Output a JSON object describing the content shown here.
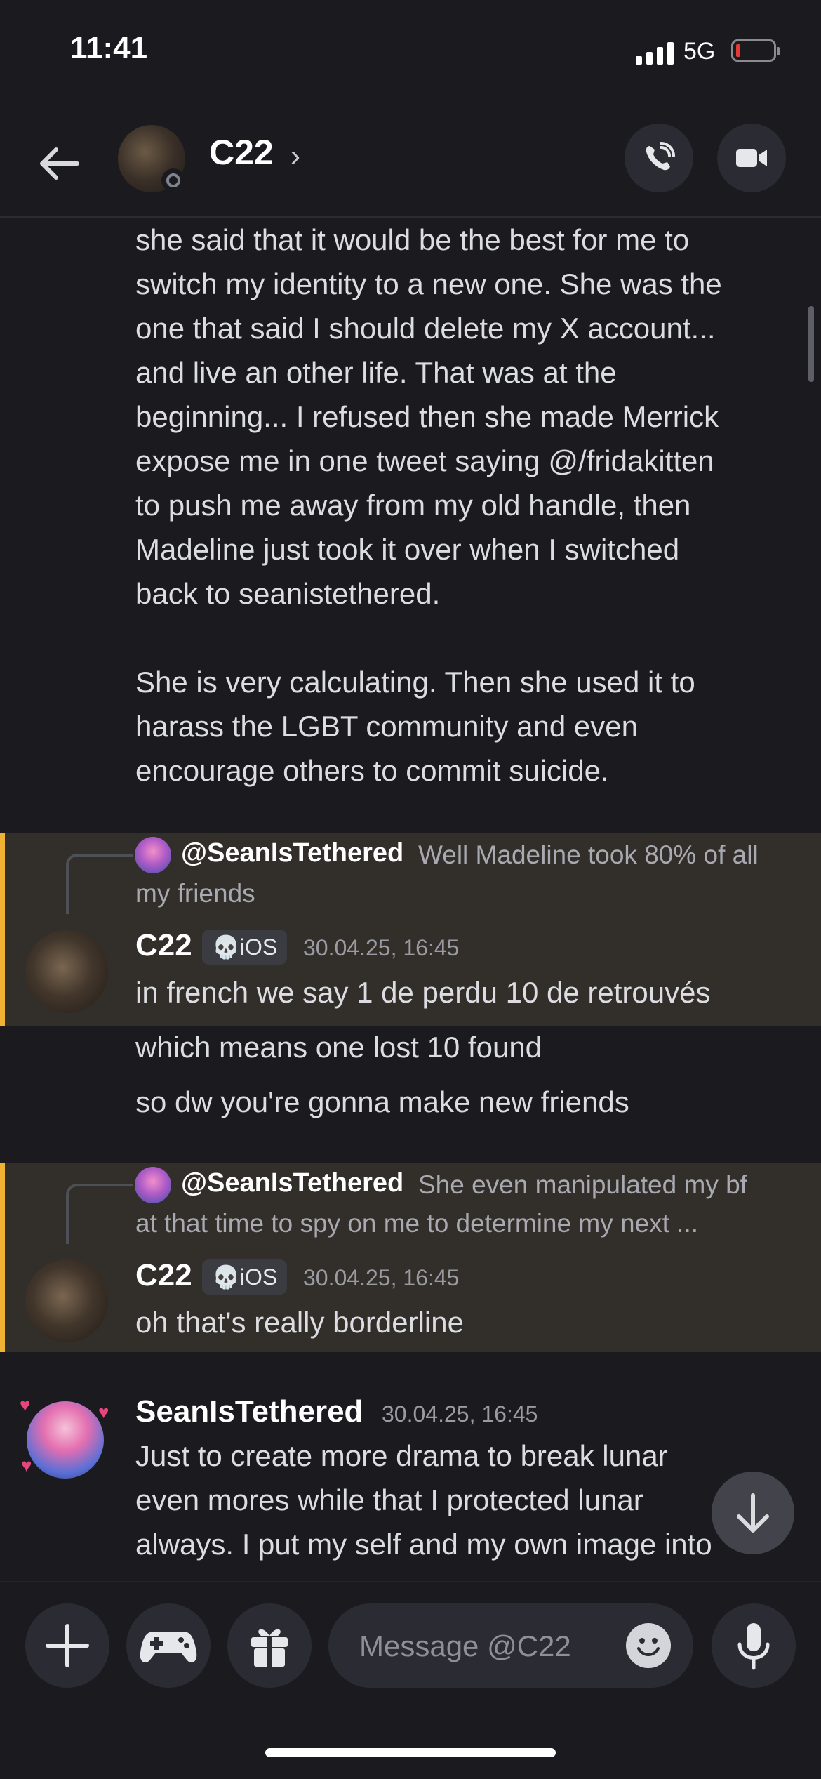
{
  "status_bar": {
    "time": "11:41",
    "network": "5G"
  },
  "header": {
    "title": "C22",
    "chevron": "›"
  },
  "messages": {
    "continued_text": "she said that it would be the best for me to\nswitch my identity to a new one. She was the\none that said I should delete my X account...\nand live an other life. That was at the\nbeginning... I refused then she made Merrick\nexpose me in one tweet saying @/fridakitten\nto push me away from my old handle, then\nMadeline just took it over when I switched\nback to seanistethered.\n\nShe is very calculating. Then she used it to\nharass the LGBT community and even\nencourage others to commit suicide.",
    "group1": {
      "reply": {
        "name": "@SeanIsTethered",
        "text": "Well Madeline took 80% of all",
        "text2": "my friends"
      },
      "author": "C22",
      "badge": "💀iOS",
      "timestamp": "30.04.25, 16:45",
      "lines": [
        "in french we say 1 de perdu 10 de retrouvés",
        "which means one lost 10 found",
        "so dw you're gonna make new friends"
      ]
    },
    "group2": {
      "reply": {
        "name": "@SeanIsTethered",
        "text": "She even manipulated my bf",
        "text2": "at that time to spy on me to determine my next ..."
      },
      "author": "C22",
      "badge": "💀iOS",
      "timestamp": "30.04.25, 16:45",
      "lines": [
        "oh that's really borderline"
      ]
    },
    "group3": {
      "author": "SeanIsTethered",
      "timestamp": "30.04.25, 16:45",
      "text": "Just to create more drama to break lunar\neven mores while that I protected lunar\nalways. I put my self and my own image into"
    }
  },
  "composer": {
    "placeholder": "Message @C22"
  },
  "colors": {
    "background": "#1a1a1f",
    "highlight": "#322e2a",
    "mention_bar": "#f0b232"
  }
}
